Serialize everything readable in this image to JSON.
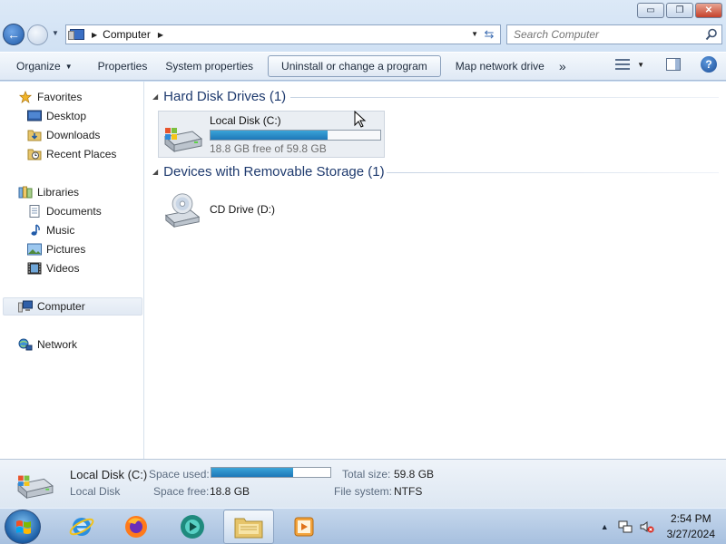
{
  "window": {
    "minimize_glyph": "▭",
    "maximize_glyph": "❐",
    "close_glyph": "✕"
  },
  "address_bar": {
    "location": "Computer",
    "search_placeholder": "Search Computer"
  },
  "command_bar": {
    "organize": "Organize",
    "properties": "Properties",
    "system_properties": "System properties",
    "uninstall": "Uninstall or change a program",
    "map_network_drive": "Map network drive",
    "more": "»"
  },
  "nav_pane": {
    "favorites": "Favorites",
    "desktop": "Desktop",
    "downloads": "Downloads",
    "recent_places": "Recent Places",
    "libraries": "Libraries",
    "documents": "Documents",
    "music": "Music",
    "pictures": "Pictures",
    "videos": "Videos",
    "computer": "Computer",
    "network": "Network"
  },
  "content": {
    "hard_disk_group": "Hard Disk Drives (1)",
    "removable_group": "Devices with Removable Storage (1)",
    "local_disk": {
      "name": "Local Disk (C:)",
      "free_text": "18.8 GB free of 59.8 GB",
      "used_fraction": 0.69
    },
    "cd_drive": {
      "name": "CD Drive (D:)"
    }
  },
  "details": {
    "name": "Local Disk (C:)",
    "type": "Local Disk",
    "space_used_label": "Space used:",
    "space_free_label": "Space free:",
    "space_free_value": "18.8 GB",
    "total_size_label": "Total size:",
    "total_size_value": "59.8 GB",
    "file_system_label": "File system:",
    "file_system_value": "NTFS",
    "used_fraction": 0.69
  },
  "taskbar": {
    "time": "2:54 PM",
    "date": "3/27/2024"
  },
  "colors": {
    "accent": "#1e78b8",
    "group_heading": "#1e3a6e"
  }
}
